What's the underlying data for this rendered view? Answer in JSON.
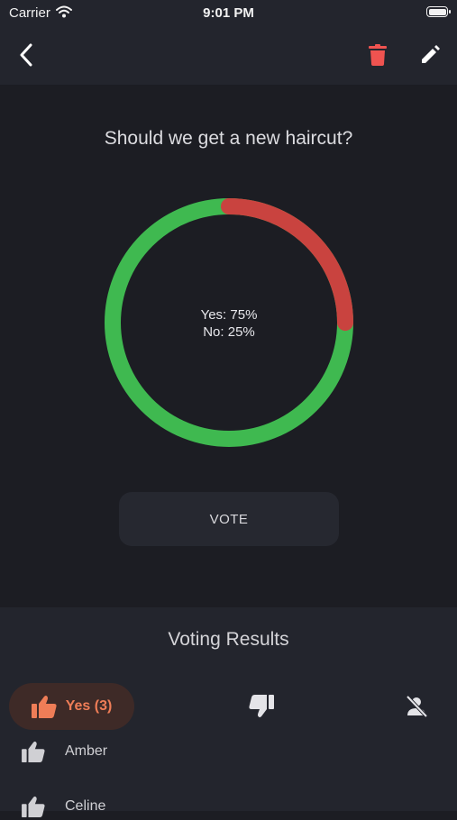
{
  "status": {
    "carrier": "Carrier",
    "time": "9:01 PM"
  },
  "colors": {
    "yes": "#3fb950",
    "no": "#c9433f",
    "accent": "#ef7d57",
    "delete": "#ef5350"
  },
  "poll": {
    "question": "Should we get a new haircut?",
    "yes_text": "Yes: 75%",
    "no_text": "No: 25%",
    "yes_percent": 75,
    "no_percent": 25,
    "vote_label": "VOTE"
  },
  "results": {
    "title": "Voting Results",
    "yes_tab": "Yes (3)",
    "voters": [
      "Amber",
      "Celine"
    ]
  }
}
